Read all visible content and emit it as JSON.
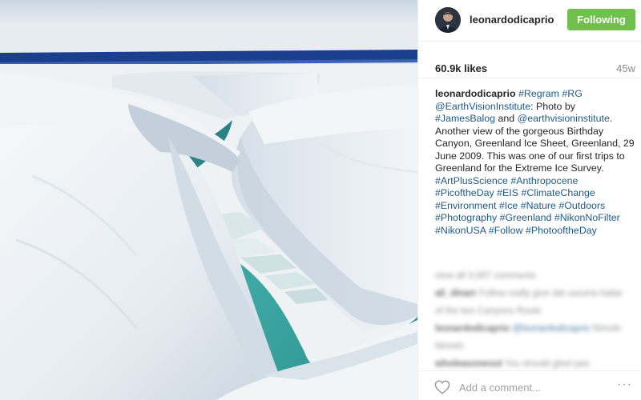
{
  "post": {
    "username": "leonardodicaprio",
    "follow_label": "Following",
    "likes": "60.9k likes",
    "time_ago": "45w",
    "caption": {
      "username": "leonardodicaprio",
      "segments": [
        {
          "text": "#Regram",
          "link": true
        },
        {
          "text": " ",
          "link": false
        },
        {
          "text": "#RG",
          "link": true
        },
        {
          "text": " ",
          "link": false
        },
        {
          "text": "@EarthVisionInstitute",
          "link": true
        },
        {
          "text": ": Photo by ",
          "link": false
        },
        {
          "text": "#JamesBalog",
          "link": true
        },
        {
          "text": " and ",
          "link": false
        },
        {
          "text": "@earthvisioninstitute",
          "link": true
        },
        {
          "text": ". Another view of the gorgeous Birthday Canyon, Greenland Ice Sheet, Greenland, 29 June 2009. This was one of our first trips to Greenland for the Extreme Ice Survey. ",
          "link": false
        },
        {
          "text": "#ArtPlusScience",
          "link": true
        },
        {
          "text": " ",
          "link": false
        },
        {
          "text": "#Anthropocene",
          "link": true
        },
        {
          "text": " ",
          "link": false
        },
        {
          "text": "#PicoftheDay",
          "link": true
        },
        {
          "text": " ",
          "link": false
        },
        {
          "text": "#EIS",
          "link": true
        },
        {
          "text": " ",
          "link": false
        },
        {
          "text": "#ClimateChange",
          "link": true
        },
        {
          "text": " ",
          "link": false
        },
        {
          "text": "#Environment",
          "link": true
        },
        {
          "text": " ",
          "link": false
        },
        {
          "text": "#Ice",
          "link": true
        },
        {
          "text": " ",
          "link": false
        },
        {
          "text": "#Nature",
          "link": true
        },
        {
          "text": " ",
          "link": false
        },
        {
          "text": "#Outdoors",
          "link": true
        },
        {
          "text": " ",
          "link": false
        },
        {
          "text": "#Photography",
          "link": true
        },
        {
          "text": " ",
          "link": false
        },
        {
          "text": "#Greenland",
          "link": true
        },
        {
          "text": " ",
          "link": false
        },
        {
          "text": "#NikonNoFilter",
          "link": true
        },
        {
          "text": " ",
          "link": false
        },
        {
          "text": "#NikonUSA",
          "link": true
        },
        {
          "text": " ",
          "link": false
        },
        {
          "text": "#Follow",
          "link": true
        },
        {
          "text": " ",
          "link": false
        },
        {
          "text": "#PhotooftheDay",
          "link": true
        }
      ]
    },
    "comment_placeholder": "Add a comment...",
    "more_label": "···",
    "icons": {
      "heart": "heart-icon",
      "more": "more-options-icon",
      "avatar": "avatar"
    },
    "colors": {
      "following_button": "#70c050",
      "link": "#1e5a8c",
      "username": "#262626",
      "meta_gray": "#8a8a8a"
    }
  }
}
